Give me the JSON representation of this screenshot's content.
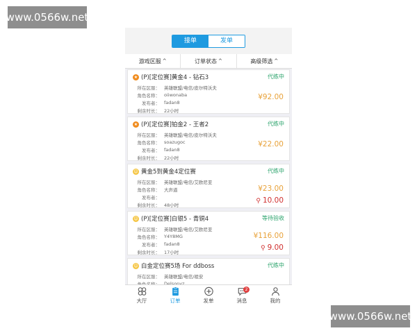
{
  "watermark": "www.0566w.net",
  "tabs": {
    "receive": "接单",
    "publish": "发单"
  },
  "filters": [
    {
      "label": "游戏区服"
    },
    {
      "label": "订单状态"
    },
    {
      "label": "高级筛选"
    }
  ],
  "labels": {
    "server": "所在区服：",
    "role": "角色名称：",
    "publisher": "发布者：",
    "remaining": "剩余时长："
  },
  "orders": [
    {
      "icon": "star-icon",
      "title": "(P)[定位赛]黄金4 - 钻石3",
      "status": "代练中",
      "server": "英雄联盟/电信/皮尔特沃夫",
      "role": "oiiwonaba",
      "publisher": "fadan8",
      "remaining": "22小时",
      "price": "¥92.00",
      "bonus": ""
    },
    {
      "icon": "star-icon",
      "title": "(P)[定位赛]铂金2 - 王者2",
      "status": "代练中",
      "server": "英雄联盟/电信/皮尔特沃夫",
      "role": "soazugoc",
      "publisher": "fadan8",
      "remaining": "22小时",
      "price": "¥22.00",
      "bonus": ""
    },
    {
      "icon": "smile-icon",
      "title": "黄金5到黄金4定位赛",
      "status": "代练中",
      "server": "英雄联盟/电信/艾欧尼亚",
      "role": "大声道",
      "publisher": "",
      "remaining": "48小时",
      "price": "¥23.00",
      "bonus": "10.00"
    },
    {
      "icon": "smile-icon",
      "title": "(P)[定位赛]白银5 - 青铜4",
      "status": "等待验收",
      "server": "英雄联盟/电信/艾欧尼亚",
      "role": "Y4Y8MG",
      "publisher": "fadan8",
      "remaining": "17小时",
      "price": "¥116.00",
      "bonus": "9.00"
    },
    {
      "icon": "smile-icon",
      "title": "白金定位赛5场 For ddboss",
      "status": "代练中",
      "server": "英雄联盟/电信/祖安",
      "role": "Delsonyz",
      "publisher": "",
      "remaining": "",
      "price": "",
      "bonus": ""
    }
  ],
  "tabbar": [
    {
      "label": "大厅",
      "icon": "clover-icon"
    },
    {
      "label": "订单",
      "icon": "clipboard-icon"
    },
    {
      "label": "发单",
      "icon": "plus-circle-icon"
    },
    {
      "label": "消息",
      "icon": "chat-icon",
      "badge": "2"
    },
    {
      "label": "我的",
      "icon": "user-icon"
    }
  ]
}
